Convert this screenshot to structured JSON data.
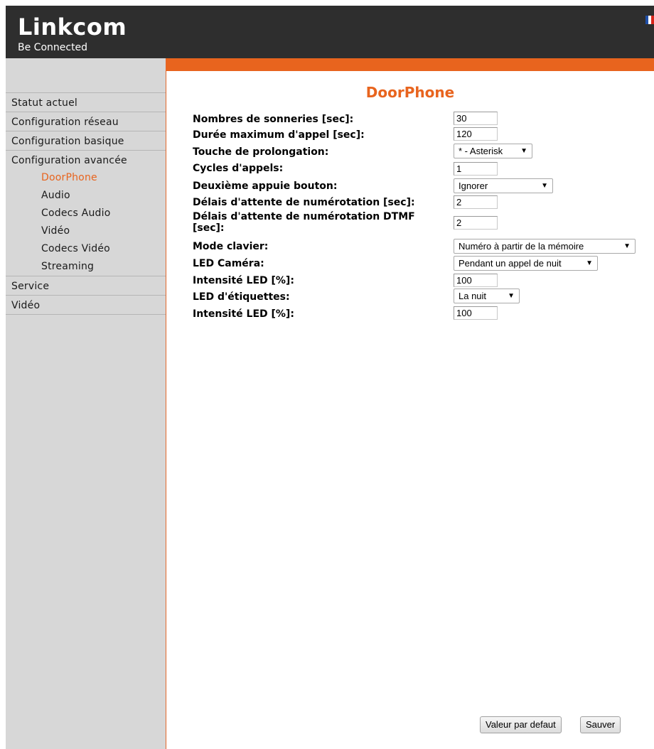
{
  "header": {
    "title": "Linkcom",
    "subtitle": "Be Connected",
    "flag_colors": [
      "#1f4fa8",
      "#ffffff",
      "#d9261c"
    ]
  },
  "sidebar": {
    "items": [
      {
        "label": "Statut actuel"
      },
      {
        "label": "Configuration réseau"
      },
      {
        "label": "Configuration basique"
      },
      {
        "label": "Configuration avancée",
        "children": [
          "DoorPhone",
          "Audio",
          "Codecs Audio",
          "Vidéo",
          "Codecs Vidéo",
          "Streaming"
        ],
        "active_child": "DoorPhone"
      },
      {
        "label": "Service"
      },
      {
        "label": "Vidéo"
      }
    ]
  },
  "page": {
    "title": "DoorPhone"
  },
  "form": {
    "rings_label": "Nombres de sonneries [sec]:",
    "rings_value": "30",
    "maxcall_label": "Durée maximum d'appel [sec]:",
    "maxcall_value": "120",
    "extend_label": "Touche de prolongation:",
    "extend_value": "* - Asterisk",
    "cycles_label": "Cycles d'appels:",
    "cycles_value": "1",
    "second_label": "Deuxième appuie bouton:",
    "second_value": "Ignorer",
    "dialwait_label": "Délais d'attente de numérotation [sec]:",
    "dialwait_value": "2",
    "dtmfwait_label_1": "Délais d'attente de numérotation DTMF",
    "dtmfwait_label_2": "[sec]:",
    "dtmfwait_value": "2",
    "keypad_label": "Mode clavier:",
    "keypad_value": "Numéro à partir de la mémoire",
    "ledcam_label": "LED Caméra:",
    "ledcam_value": "Pendant un appel de nuit",
    "ledcam_int_label": "Intensité LED [%]:",
    "ledcam_int_value": "100",
    "ledlabel_label": "LED d'étiquettes:",
    "ledlabel_value": "La nuit",
    "ledlabel_int_label": "Intensité LED [%]:",
    "ledlabel_int_value": "100"
  },
  "buttons": {
    "default": "Valeur par defaut",
    "save": "Sauver"
  },
  "colors": {
    "accent": "#e8641e",
    "header_bg": "#2e2e2e",
    "sidebar_bg": "#d7d7d7"
  }
}
